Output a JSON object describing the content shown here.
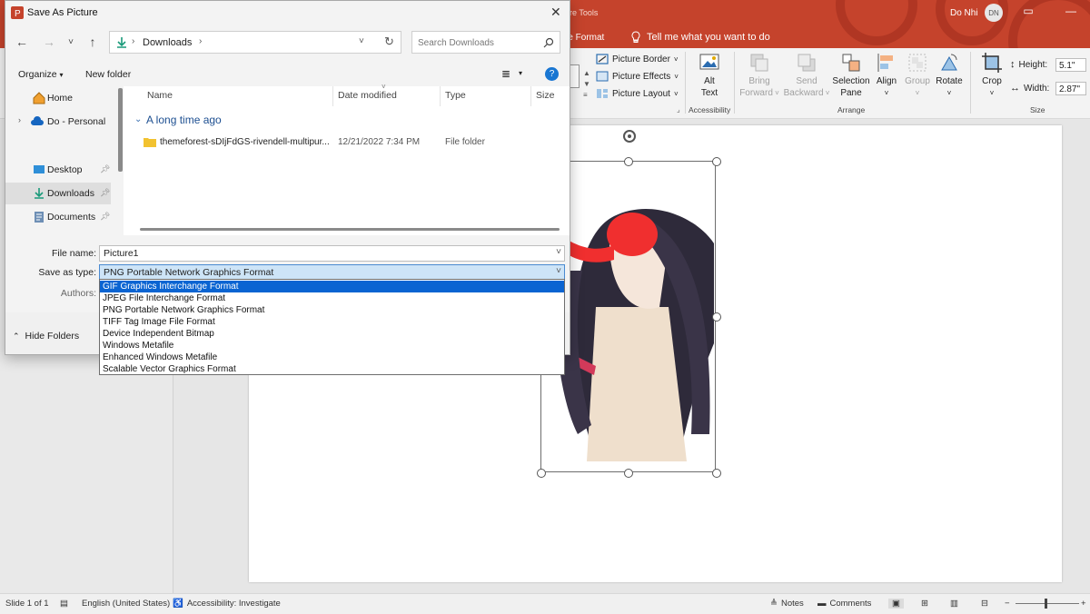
{
  "ppt": {
    "tools_label": "ure Tools",
    "format_tab": "re Format",
    "tell_me": "Tell me what you want to do",
    "user_name": "Do Nhi",
    "user_initials": "DN",
    "ribbon": {
      "picture_border": "Picture Border",
      "picture_effects": "Picture Effects",
      "picture_layout": "Picture Layout",
      "alt_text": [
        "Alt",
        "Text"
      ],
      "accessibility_group": "Accessibility",
      "bring_forward": [
        "Bring",
        "Forward"
      ],
      "send_backward": [
        "Send",
        "Backward"
      ],
      "selection_pane": [
        "Selection",
        "Pane"
      ],
      "align": "Align",
      "group": "Group",
      "rotate": "Rotate",
      "arrange_group": "Arrange",
      "crop": "Crop",
      "height_label": "Height:",
      "height_value": "5.1\"",
      "width_label": "Width:",
      "width_value": "2.87\"",
      "size_group": "Size"
    },
    "status": {
      "slide": "Slide 1 of 1",
      "language": "English (United States)",
      "accessibility": "Accessibility: Investigate",
      "notes": "Notes",
      "comments": "Comments"
    },
    "accent_color": "#c5432c"
  },
  "dialog": {
    "title": "Save As Picture",
    "address": "Downloads",
    "search_placeholder": "Search Downloads",
    "organize": "Organize",
    "new_folder": "New folder",
    "nav": [
      {
        "label": "Home",
        "icon": "home-icon"
      },
      {
        "label": "Do - Personal",
        "icon": "cloud-icon"
      },
      {
        "label": "Desktop",
        "icon": "desktop-icon"
      },
      {
        "label": "Downloads",
        "icon": "download-icon"
      },
      {
        "label": "Documents",
        "icon": "documents-icon"
      }
    ],
    "columns": [
      "Name",
      "Date modified",
      "Type",
      "Size"
    ],
    "group_header": "A long time ago",
    "files": [
      {
        "name": "themeforest-sDIjFdGS-rivendell-multipur...",
        "date": "12/21/2022 7:34 PM",
        "type": "File folder"
      }
    ],
    "file_name_label": "File name:",
    "file_name_value": "Picture1",
    "save_type_label": "Save as type:",
    "save_type_value": "PNG Portable Network Graphics Format",
    "authors_label": "Authors:",
    "hide_folders": "Hide Folders",
    "type_options": [
      "GIF Graphics Interchange Format",
      "JPEG File Interchange Format",
      "PNG Portable Network Graphics Format",
      "TIFF Tag Image File Format",
      "Device Independent Bitmap",
      "Windows Metafile",
      "Enhanced Windows Metafile",
      "Scalable Vector Graphics Format"
    ],
    "selected_option_index": 0
  }
}
